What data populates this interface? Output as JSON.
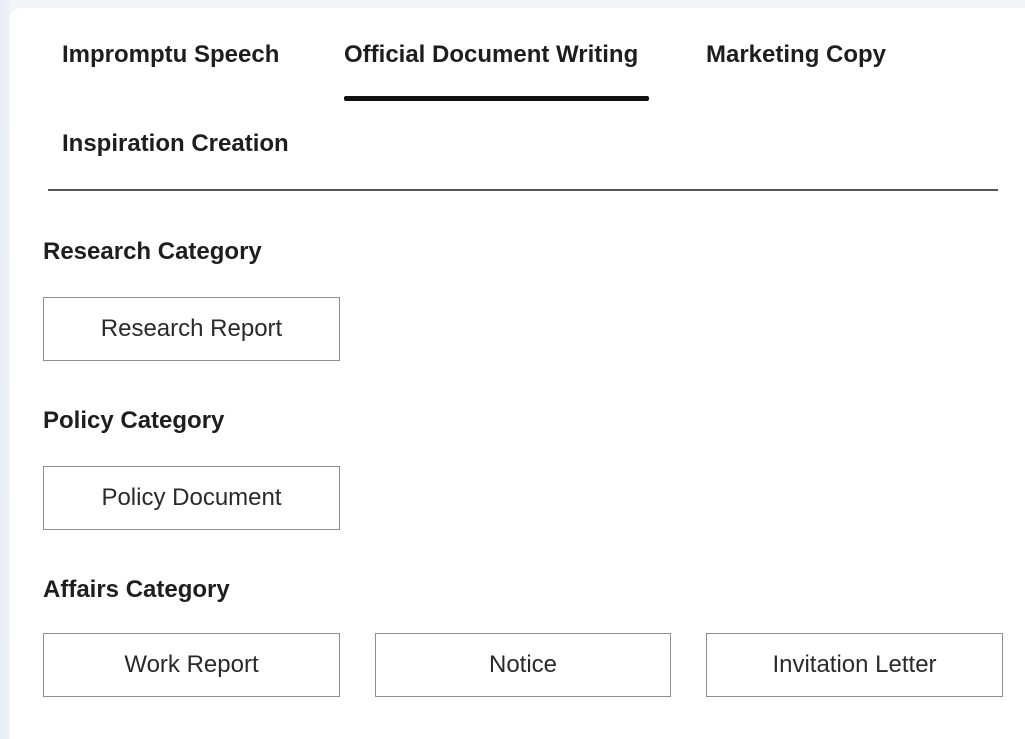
{
  "tabs": [
    {
      "label": "Impromptu Speech",
      "active": false
    },
    {
      "label": "Official Document Writing",
      "active": true
    },
    {
      "label": "Marketing Copy",
      "active": false
    },
    {
      "label": "Inspiration Creation",
      "active": false
    }
  ],
  "sections": [
    {
      "title": "Research Category",
      "options": [
        "Research Report"
      ]
    },
    {
      "title": "Policy Category",
      "options": [
        "Policy Document"
      ]
    },
    {
      "title": "Affairs Category",
      "options": [
        "Work Report",
        "Notice",
        "Invitation Letter"
      ]
    }
  ],
  "colors": {
    "active_indicator": "#111111",
    "divider": "#555555",
    "option_border": "#8f8f8f",
    "background": "#ffffff"
  }
}
